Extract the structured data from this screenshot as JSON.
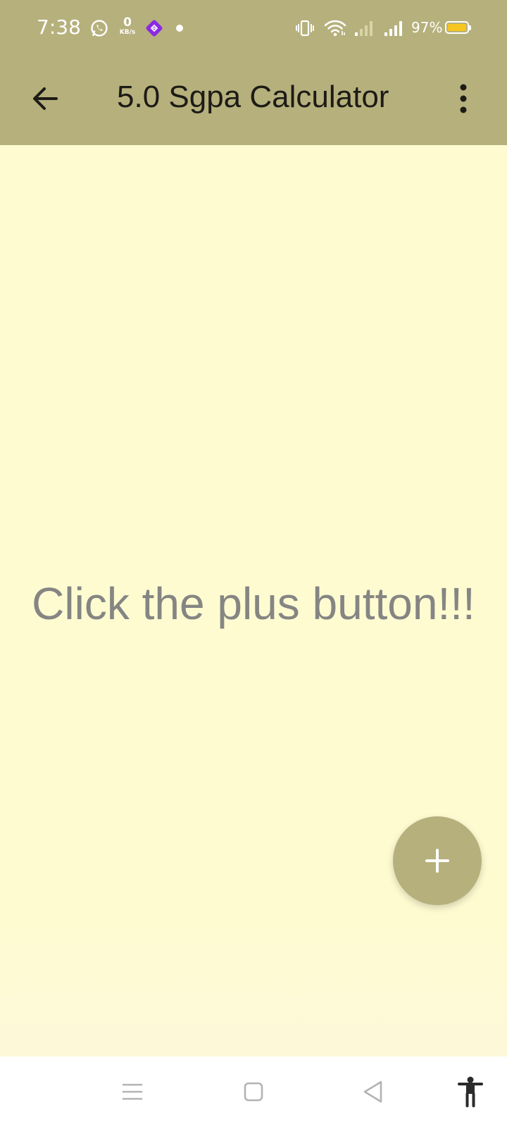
{
  "status_bar": {
    "time": "7:38",
    "data_speed_value": "0",
    "data_speed_unit": "KB/s",
    "battery_percent": "97%",
    "battery_color": "#f6c51f",
    "icons": [
      "whatsapp-icon",
      "data-speed-indicator",
      "vpn-app-icon",
      "notification-dot",
      "vibrate-icon",
      "wifi-icon",
      "signal-weak-icon",
      "signal-strong-icon",
      "battery-icon"
    ]
  },
  "app_bar": {
    "title": "5.0 Sgpa Calculator",
    "back_icon": "arrow-back-icon",
    "menu_icon": "more-vert-icon",
    "color": "#b6b07c"
  },
  "main": {
    "empty_message": "Click the plus button!!!",
    "background_color": "#fefbd1"
  },
  "fab": {
    "icon": "plus-icon",
    "color": "#b6b07c"
  },
  "nav_bar": {
    "items": [
      "recents-menu-icon",
      "home-square-icon",
      "back-triangle-icon",
      "accessibility-icon"
    ]
  }
}
